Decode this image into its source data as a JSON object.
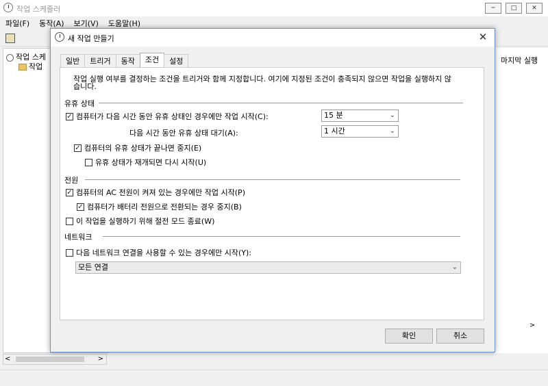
{
  "window": {
    "title": "작업 스케줄러",
    "minimize_label": "─",
    "maximize_label": "□",
    "close_label": "✕"
  },
  "menu": [
    "파일(F)",
    "동작(A)",
    "보기(V)",
    "도움말(H)"
  ],
  "tree": {
    "root_label": "작업 스케",
    "child_label": "작업"
  },
  "right_pane": {
    "column_header": "마지막 실행"
  },
  "dialog": {
    "title": "새 작업 만들기",
    "close_label": "✕",
    "tabs": [
      "일반",
      "트리거",
      "동작",
      "조건",
      "설정"
    ],
    "active_tab": "조건",
    "description": "작업 실행 여부를 결정하는 조건을 트리거와 함께 지정합니다. 여기에 지정된 조건이 충족되지 않으면 작업을 실행하지 않습니다.",
    "idle": {
      "group_label": "유휴 상태",
      "start_if_idle": {
        "label": "컴퓨터가 다음 시간 동안 유휴 상태인 경우에만 작업 시작(C):",
        "checked": true
      },
      "idle_duration": "15 분",
      "wait_label": "다음 시간 동안 유휴 상태 대기(A):",
      "wait_duration": "1 시간",
      "stop_if_not_idle": {
        "label": "컴퓨터의 유휴 상태가 끝나면 중지(E)",
        "checked": true
      },
      "restart_if_idle": {
        "label": "유휴 상태가 재개되면 다시 시작(U)",
        "checked": false
      }
    },
    "power": {
      "group_label": "전원",
      "ac_only": {
        "label": "컴퓨터의 AC 전원이 켜져 있는 경우에만 작업 시작(P)",
        "checked": true
      },
      "stop_on_battery": {
        "label": "컴퓨터가 배터리 전원으로 전환되는 경우 중지(B)",
        "checked": true
      },
      "wake": {
        "label": "이 작업을 실행하기 위해 절전 모드 종료(W)",
        "checked": false
      }
    },
    "network": {
      "group_label": "네트워크",
      "require_network": {
        "label": "다음 네트워크 연결을 사용할 수 있는 경우에만 시작(Y):",
        "checked": false
      },
      "connection": "모든 연결"
    },
    "ok_label": "확인",
    "cancel_label": "취소"
  }
}
